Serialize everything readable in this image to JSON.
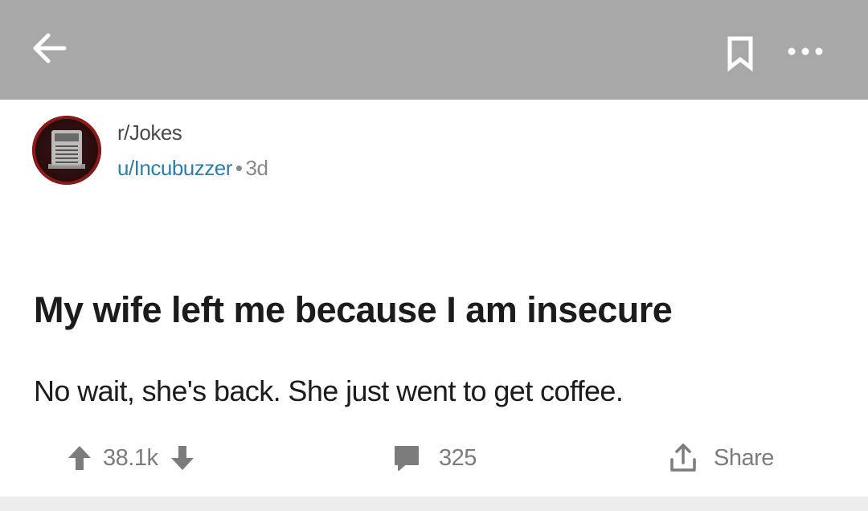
{
  "topbar": {
    "back_icon": "arrow-left-icon",
    "save_icon": "bookmark-icon",
    "more_icon": "more-horizontal-icon",
    "bar_color": "#a8a8a8"
  },
  "post": {
    "subreddit": "r/Jokes",
    "author": "u/Incubuzzer",
    "separator": "•",
    "age": "3d",
    "title": "My wife left me because I am insecure",
    "body": "No wait, she's back. She just went to get coffee."
  },
  "actions": {
    "upvote_icon": "arrow-up-icon",
    "vote_count": "38.1k",
    "downvote_icon": "arrow-down-icon",
    "comment_icon": "comment-icon",
    "comment_count": "325",
    "share_icon": "share-icon",
    "share_label": "Share"
  },
  "colors": {
    "author_link": "#2f7ea8",
    "muted_text": "#7c7c7c",
    "title_text": "#1c1c1c"
  }
}
